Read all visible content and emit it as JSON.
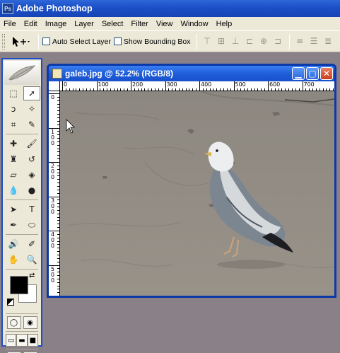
{
  "app": {
    "title": "Adobe Photoshop",
    "icon": "photoshop-app-icon"
  },
  "menu": [
    "File",
    "Edit",
    "Image",
    "Layer",
    "Select",
    "Filter",
    "View",
    "Window",
    "Help"
  ],
  "options": {
    "auto_select_label": "Auto Select Layer",
    "auto_select_checked": false,
    "bounding_box_label": "Show Bounding Box",
    "bounding_box_checked": false
  },
  "document": {
    "title": "galeb.jpg @ 52.2% (RGB/8)",
    "ruler_top_labels": [
      "0",
      "100",
      "200",
      "300",
      "400",
      "500",
      "600",
      "700"
    ],
    "ruler_left_labels": [
      "0",
      "1\n0\n0",
      "2\n0\n0",
      "3\n0\n0",
      "4\n0\n0",
      "5\n0\n0"
    ]
  },
  "colors": {
    "foreground": "#000000",
    "background": "#ffffff",
    "accent": "#1f4fc4"
  }
}
